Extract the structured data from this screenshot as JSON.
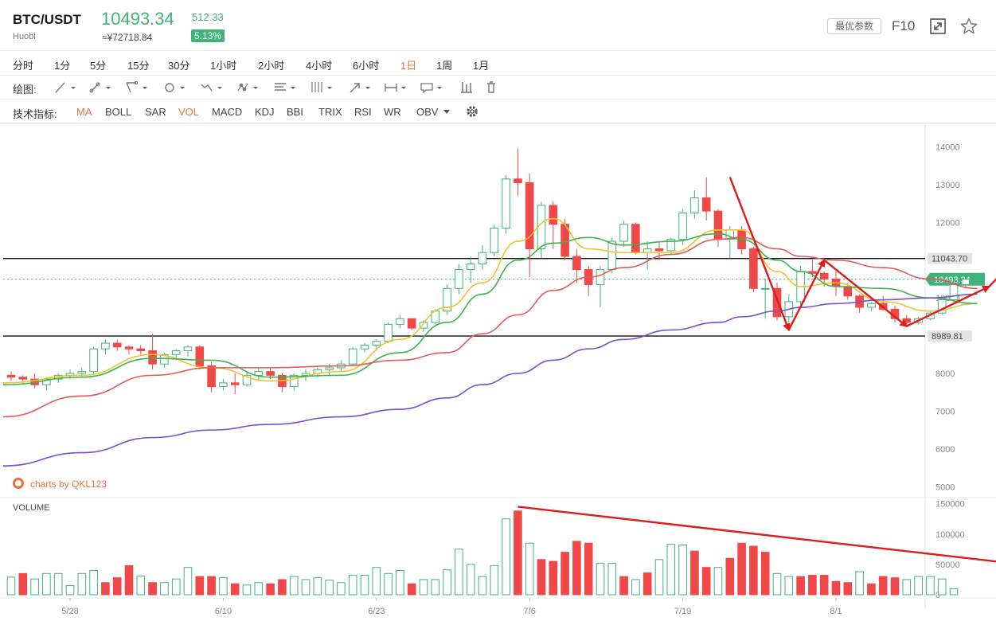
{
  "header": {
    "symbol": "BTC/USDT",
    "exchange": "Huobi",
    "last_price": "10493.34",
    "cny_price": "≈¥72718.84",
    "change": "512.33",
    "change_pct": "5.13%",
    "params_label": "最优参数",
    "f10_label": "F10"
  },
  "timeframes": [
    "分时",
    "1分",
    "5分",
    "15分",
    "30分",
    "1小时",
    "2小时",
    "4小时",
    "6小时",
    "1日",
    "1周",
    "1月"
  ],
  "active_timeframe": "1日",
  "drawing_label": "绘图:",
  "drawing_tools": [
    "line-tool",
    "ray-tool",
    "channel-tool",
    "shape-tool",
    "pattern-tool",
    "node-tool",
    "fib-tool",
    "gann-tool",
    "arrow-tool",
    "measure-tool",
    "text-tool",
    "bar-tool",
    "delete-tool"
  ],
  "indicators_label": "技术指标:",
  "indicators": [
    "MA",
    "BOLL",
    "SAR",
    "VOL",
    "MACD",
    "KDJ",
    "BBI",
    "TRIX",
    "RSI",
    "WR",
    "OBV"
  ],
  "active_indicators": [
    "MA",
    "VOL"
  ],
  "watermark": "charts by QKL123",
  "colors": {
    "up": "#3fb37a",
    "down": "#f04848",
    "ma5": "#f2c12e",
    "ma10": "#3cb34a",
    "ma30": "#e05a5a",
    "ma60": "#7b4fc9",
    "annotation": "#e01b1b"
  },
  "chart_data": [
    {
      "type": "candlestick",
      "x_start": "5/23",
      "x_step_days": 1,
      "xticks": [
        "5/28",
        "6/10",
        "6/23",
        "7/6",
        "7/19",
        "8/1"
      ],
      "yticks": [
        5000,
        6000,
        7000,
        8000,
        9000,
        10000,
        11000,
        12000,
        13000,
        14000
      ],
      "ylim": [
        4900,
        14200
      ],
      "ohlc": [
        [
          7950,
          8050,
          7800,
          7900
        ],
        [
          7900,
          7950,
          7700,
          7850
        ],
        [
          7850,
          8000,
          7600,
          7700
        ],
        [
          7700,
          7900,
          7550,
          7850
        ],
        [
          7850,
          8000,
          7750,
          7950
        ],
        [
          7950,
          8100,
          7850,
          8000
        ],
        [
          8000,
          8150,
          7900,
          8050
        ],
        [
          8050,
          8700,
          8000,
          8650
        ],
        [
          8650,
          8900,
          8500,
          8800
        ],
        [
          8800,
          8900,
          8600,
          8700
        ],
        [
          8700,
          8750,
          8500,
          8650
        ],
        [
          8650,
          8750,
          8500,
          8600
        ],
        [
          8600,
          9050,
          8100,
          8250
        ],
        [
          8250,
          8550,
          8150,
          8500
        ],
        [
          8500,
          8650,
          8350,
          8600
        ],
        [
          8600,
          8750,
          8450,
          8700
        ],
        [
          8700,
          8750,
          8100,
          8200
        ],
        [
          8200,
          8300,
          7500,
          7650
        ],
        [
          7650,
          7850,
          7550,
          7750
        ],
        [
          7750,
          8000,
          7450,
          7700
        ],
        [
          7700,
          8050,
          7650,
          7950
        ],
        [
          7950,
          8150,
          7800,
          8050
        ],
        [
          8050,
          8150,
          7850,
          7950
        ],
        [
          7950,
          8000,
          7500,
          7650
        ],
        [
          7650,
          8000,
          7550,
          7950
        ],
        [
          7950,
          8100,
          7800,
          8000
        ],
        [
          8000,
          8150,
          7900,
          8100
        ],
        [
          8100,
          8250,
          7950,
          8150
        ],
        [
          8150,
          8350,
          8050,
          8250
        ],
        [
          8250,
          8700,
          8200,
          8650
        ],
        [
          8650,
          8800,
          8550,
          8750
        ],
        [
          8750,
          8900,
          8600,
          8850
        ],
        [
          8850,
          9350,
          8800,
          9300
        ],
        [
          9300,
          9550,
          9200,
          9450
        ],
        [
          9450,
          9450,
          9150,
          9200
        ],
        [
          9200,
          9400,
          9100,
          9350
        ],
        [
          9350,
          9700,
          9300,
          9650
        ],
        [
          9650,
          10350,
          9550,
          10250
        ],
        [
          10250,
          10900,
          10100,
          10750
        ],
        [
          10750,
          11100,
          10400,
          10900
        ],
        [
          10900,
          11400,
          10750,
          11200
        ],
        [
          11200,
          11950,
          11100,
          11850
        ],
        [
          11850,
          13250,
          11700,
          13150
        ],
        [
          13150,
          13950,
          12700,
          13050
        ],
        [
          13050,
          13300,
          10550,
          11300
        ],
        [
          11300,
          12550,
          11050,
          12450
        ],
        [
          12450,
          12550,
          11300,
          11950
        ],
        [
          11950,
          12100,
          11000,
          11100
        ],
        [
          11100,
          11300,
          10400,
          10750
        ],
        [
          10750,
          10850,
          10050,
          10350
        ],
        [
          10350,
          10850,
          9750,
          10750
        ],
        [
          10750,
          11600,
          10650,
          11500
        ],
        [
          11500,
          12050,
          11350,
          11950
        ],
        [
          11950,
          12000,
          11150,
          11200
        ],
        [
          11200,
          11500,
          10750,
          11300
        ],
        [
          11300,
          11500,
          11000,
          11250
        ],
        [
          11250,
          11600,
          11150,
          11550
        ],
        [
          11550,
          12350,
          11400,
          12250
        ],
        [
          12250,
          12850,
          12100,
          12650
        ],
        [
          12650,
          13200,
          12050,
          12300
        ],
        [
          12300,
          12350,
          11350,
          11550
        ],
        [
          11550,
          11900,
          11050,
          11800
        ],
        [
          11800,
          11900,
          11150,
          11300
        ],
        [
          11300,
          11350,
          10150,
          10250
        ],
        [
          10250,
          10500,
          9450,
          10250
        ],
        [
          10250,
          10400,
          9400,
          9500
        ],
        [
          9500,
          10100,
          9350,
          9900
        ],
        [
          9900,
          10850,
          9750,
          10700
        ],
        [
          10700,
          11000,
          10550,
          10650
        ],
        [
          10650,
          10700,
          10300,
          10500
        ],
        [
          10500,
          10700,
          10050,
          10300
        ],
        [
          10300,
          10400,
          9950,
          10050
        ],
        [
          10050,
          10100,
          9600,
          9750
        ],
        [
          9750,
          9900,
          9650,
          9850
        ],
        [
          9850,
          10050,
          9650,
          9700
        ],
        [
          9700,
          9800,
          9350,
          9450
        ],
        [
          9450,
          9550,
          9250,
          9350
        ],
        [
          9350,
          9500,
          9300,
          9450
        ],
        [
          9450,
          9650,
          9400,
          9600
        ],
        [
          9600,
          9950,
          9550,
          9950
        ],
        [
          9950,
          10450,
          9850,
          10350
        ],
        [
          10350,
          10600,
          10250,
          10493.34
        ]
      ],
      "ma_series": [
        {
          "name": "MA5",
          "points": [
            [
              0,
              7750
            ],
            [
              6,
              7950
            ],
            [
              12,
              8500
            ],
            [
              17,
              8150
            ],
            [
              22,
              7800
            ],
            [
              28,
              8050
            ],
            [
              33,
              8900
            ],
            [
              37,
              9750
            ],
            [
              40,
              10400
            ],
            [
              43,
              11500
            ],
            [
              46,
              12100
            ],
            [
              49,
              11300
            ],
            [
              52,
              11200
            ],
            [
              56,
              11200
            ],
            [
              60,
              11800
            ],
            [
              62,
              11800
            ],
            [
              65,
              10700
            ],
            [
              67,
              10300
            ],
            [
              70,
              10400
            ],
            [
              74,
              9900
            ],
            [
              78,
              9650
            ],
            [
              82,
              9850
            ]
          ]
        },
        {
          "name": "MA10",
          "points": [
            [
              0,
              7700
            ],
            [
              6,
              7900
            ],
            [
              12,
              8400
            ],
            [
              17,
              8350
            ],
            [
              22,
              7900
            ],
            [
              28,
              7950
            ],
            [
              33,
              8550
            ],
            [
              37,
              9350
            ],
            [
              40,
              10100
            ],
            [
              43,
              11000
            ],
            [
              46,
              11450
            ],
            [
              49,
              11600
            ],
            [
              52,
              11400
            ],
            [
              56,
              11500
            ],
            [
              60,
              11700
            ],
            [
              62,
              11550
            ],
            [
              65,
              11000
            ],
            [
              67,
              10700
            ],
            [
              70,
              10300
            ],
            [
              74,
              10250
            ],
            [
              78,
              10000
            ],
            [
              82,
              9850
            ]
          ]
        },
        {
          "name": "MA30",
          "points": [
            [
              0,
              6850
            ],
            [
              6,
              7400
            ],
            [
              12,
              7950
            ],
            [
              17,
              8150
            ],
            [
              22,
              8150
            ],
            [
              28,
              8200
            ],
            [
              33,
              8350
            ],
            [
              37,
              8550
            ],
            [
              40,
              9050
            ],
            [
              43,
              9550
            ],
            [
              46,
              10200
            ],
            [
              49,
              10550
            ],
            [
              52,
              10800
            ],
            [
              56,
              11150
            ],
            [
              60,
              11550
            ],
            [
              62,
              11600
            ],
            [
              65,
              11300
            ],
            [
              67,
              11100
            ],
            [
              70,
              11000
            ],
            [
              74,
              10800
            ],
            [
              78,
              10500
            ],
            [
              82,
              10250
            ]
          ]
        },
        {
          "name": "MA60",
          "points": [
            [
              0,
              5550
            ],
            [
              6,
              5900
            ],
            [
              12,
              6300
            ],
            [
              17,
              6500
            ],
            [
              22,
              6650
            ],
            [
              28,
              6850
            ],
            [
              33,
              7050
            ],
            [
              37,
              7350
            ],
            [
              40,
              7700
            ],
            [
              43,
              8000
            ],
            [
              46,
              8350
            ],
            [
              49,
              8650
            ],
            [
              52,
              8900
            ],
            [
              56,
              9150
            ],
            [
              60,
              9350
            ],
            [
              62,
              9500
            ],
            [
              65,
              9650
            ],
            [
              67,
              9750
            ],
            [
              70,
              9850
            ],
            [
              74,
              9950
            ],
            [
              78,
              10000
            ],
            [
              82,
              10100
            ]
          ]
        }
      ],
      "horizontal_levels": [
        11043.7,
        8989.81
      ],
      "level_labels": [
        "11043.70",
        "8989.81"
      ],
      "current_price": 10493.34,
      "current_price_label": "10493.34",
      "annotations": [
        {
          "type": "zigzag",
          "points": [
            [
              61,
              13200
            ],
            [
              66,
              9150
            ],
            [
              69,
              11000
            ],
            [
              76,
              9250
            ],
            [
              83,
              10300
            ]
          ],
          "arrow_end": [
            85,
            10950
          ]
        }
      ]
    },
    {
      "type": "bar",
      "title": "VOLUME",
      "yticks": [
        0,
        50000,
        100000,
        150000
      ],
      "ylim": [
        0,
        160000
      ],
      "values": [
        29000,
        35000,
        26000,
        35000,
        35000,
        15000,
        35000,
        40000,
        20000,
        28000,
        48000,
        31000,
        20000,
        20000,
        26000,
        45000,
        30000,
        30000,
        28000,
        18000,
        16000,
        20000,
        18000,
        25000,
        30000,
        25000,
        28000,
        24000,
        20000,
        32000,
        32000,
        45000,
        35000,
        40000,
        18000,
        25000,
        25000,
        41000,
        75000,
        50000,
        30000,
        48000,
        125000,
        138000,
        85000,
        58000,
        55000,
        70000,
        88000,
        85000,
        52000,
        52000,
        30000,
        25000,
        36000,
        58000,
        83000,
        82000,
        72000,
        45000,
        45000,
        60000,
        85000,
        80000,
        70000,
        35000,
        30000,
        30000,
        32000,
        32000,
        22000,
        20000,
        38000,
        18000,
        30000,
        28000,
        25000,
        30000,
        30000,
        26000,
        10000
      ],
      "up": [
        true,
        false,
        true,
        true,
        true,
        true,
        true,
        true,
        false,
        false,
        false,
        true,
        false,
        true,
        true,
        true,
        false,
        false,
        true,
        false,
        true,
        true,
        false,
        false,
        true,
        true,
        true,
        true,
        true,
        true,
        true,
        true,
        true,
        true,
        false,
        true,
        true,
        true,
        true,
        true,
        true,
        true,
        true,
        false,
        true,
        false,
        false,
        false,
        false,
        false,
        true,
        true,
        false,
        true,
        false,
        true,
        true,
        true,
        false,
        false,
        true,
        false,
        false,
        false,
        false,
        true,
        true,
        false,
        false,
        false,
        false,
        false,
        true,
        false,
        false,
        false,
        true,
        true,
        true,
        true,
        true
      ],
      "annotations": [
        {
          "type": "trend-arrow",
          "from": [
            43,
            145000
          ],
          "to": [
            88,
            45000
          ]
        }
      ]
    }
  ]
}
